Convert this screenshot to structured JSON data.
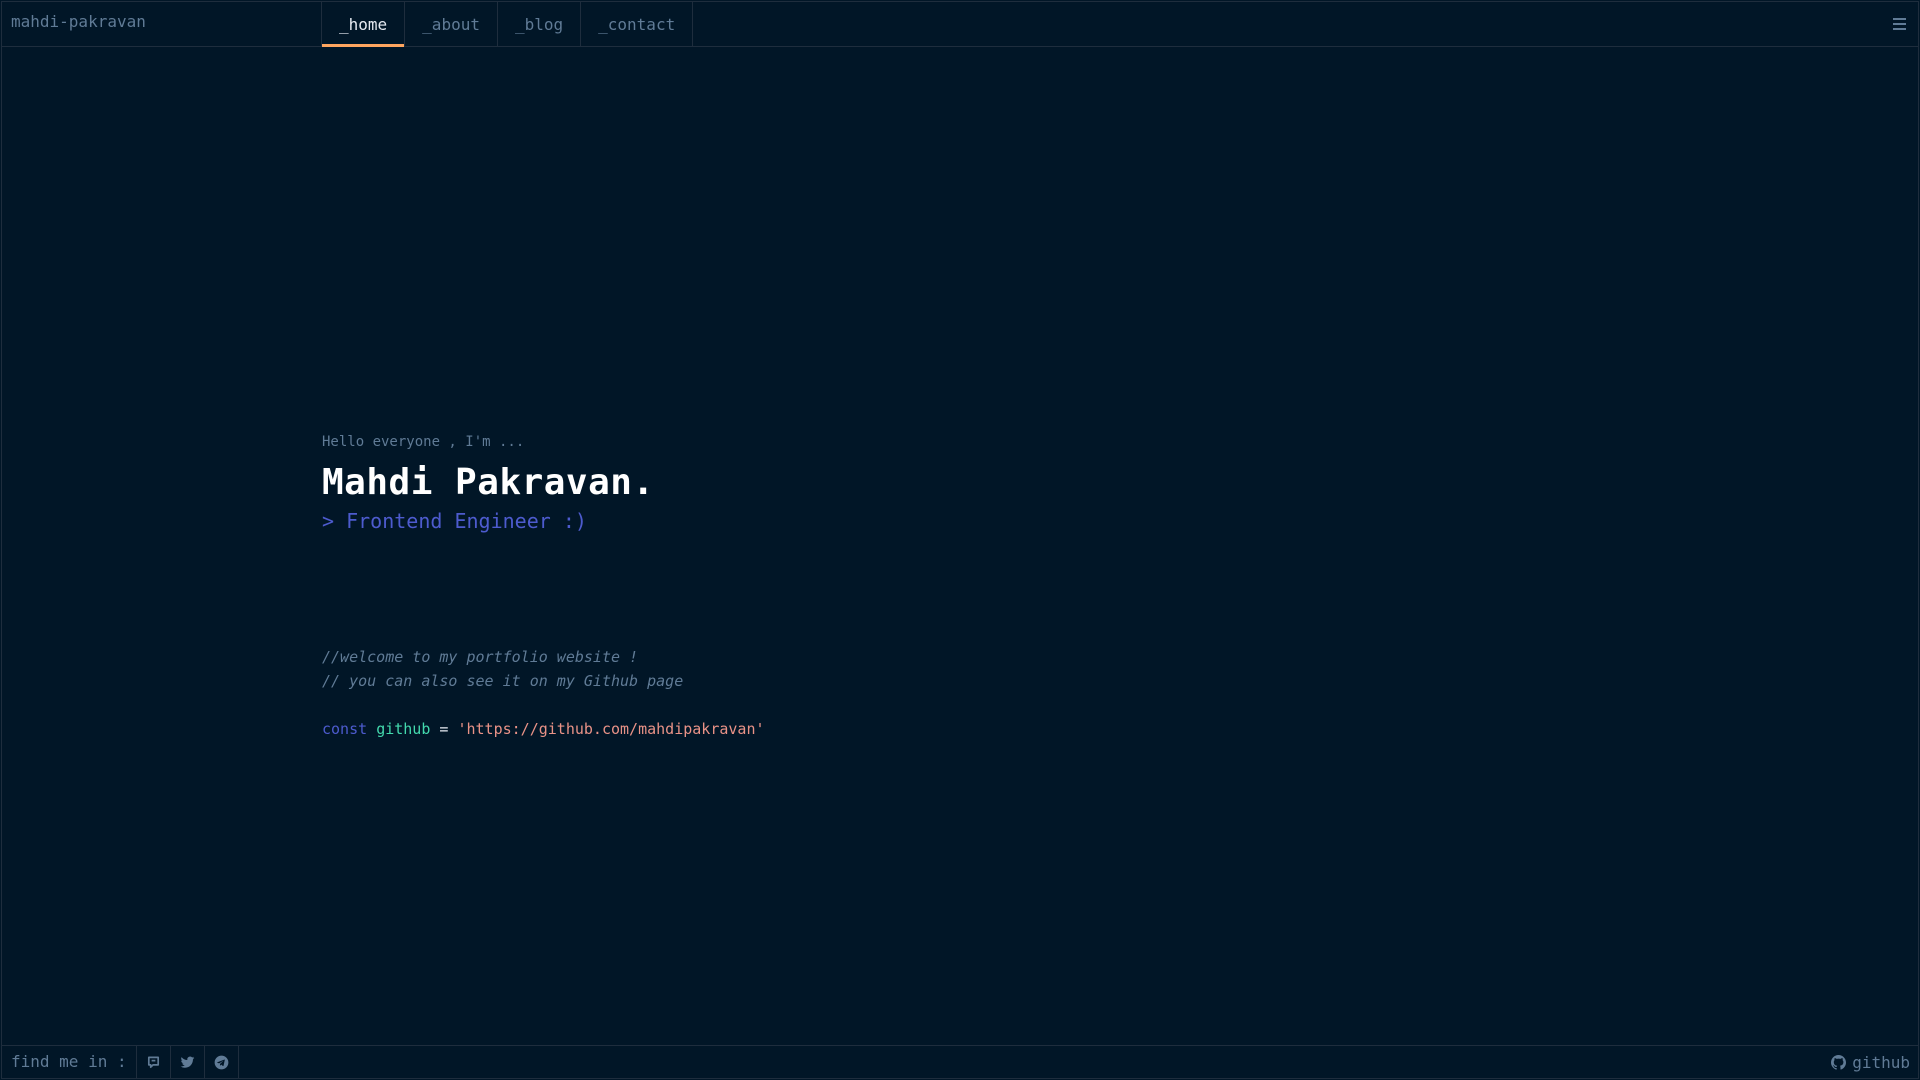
{
  "header": {
    "brand": "mahdi-pakravan",
    "tabs": [
      {
        "label": "_home",
        "active": true
      },
      {
        "label": "_about",
        "active": false
      },
      {
        "label": "_blog",
        "active": false
      },
      {
        "label": "_contact",
        "active": false
      }
    ],
    "menu_icon": "hamburger-menu-icon"
  },
  "hero": {
    "greeting": "Hello everyone , I'm ...",
    "name": "Mahdi Pakravan.",
    "role": "> Frontend Engineer :)"
  },
  "code": {
    "comment_1": "//welcome to my portfolio website !",
    "comment_2": "// you can also see it on my Github page",
    "keyword": "const",
    "variable": "github",
    "operator": "=",
    "value": "'https://github.com/mahdipakravan'"
  },
  "footer": {
    "find_label": "find me in :",
    "socials": [
      "chat-icon",
      "twitter-icon",
      "telegram-icon"
    ],
    "github_label": "github"
  },
  "colors": {
    "background": "#011627",
    "border": "#1e2d3d",
    "muted_text": "#607b96",
    "accent_tab": "#fea55f",
    "keyword": "#4d5bce",
    "variable": "#43d9ad",
    "string": "#e99287"
  }
}
